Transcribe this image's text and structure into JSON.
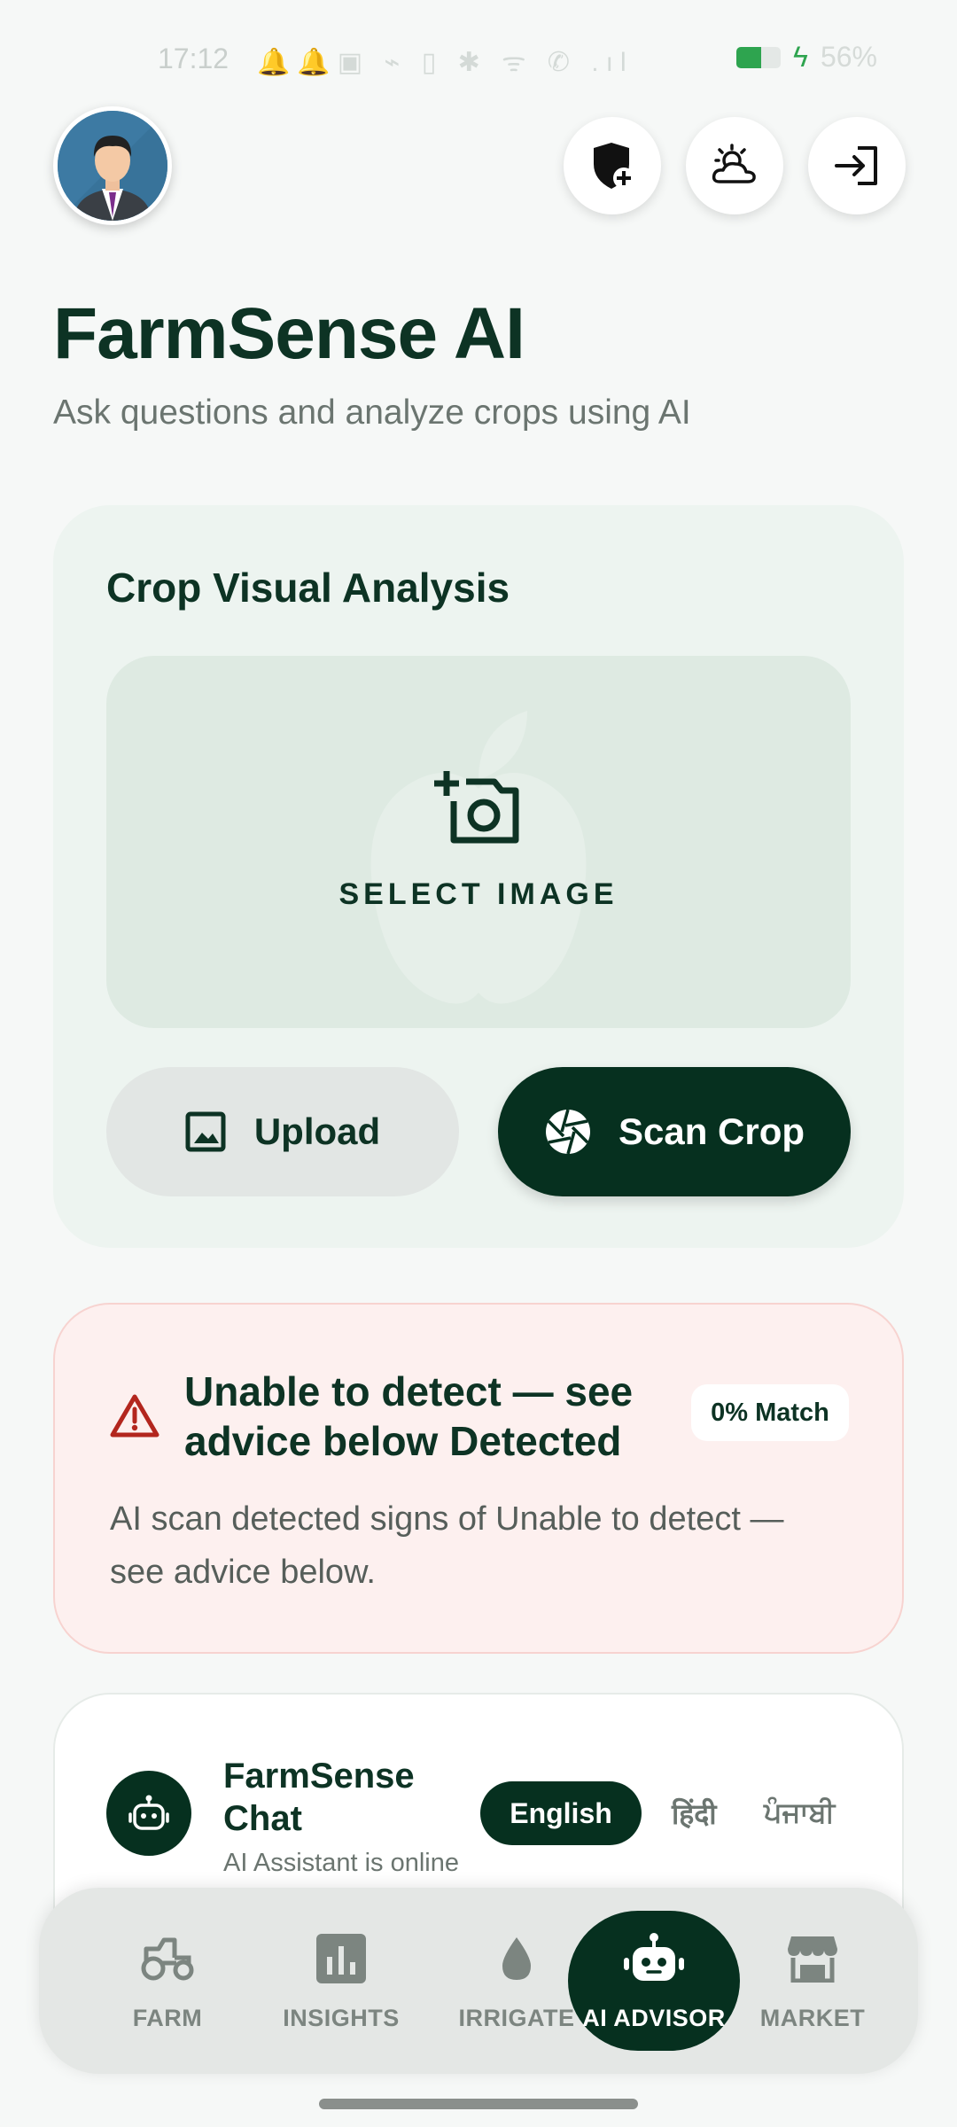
{
  "status_bar": {
    "time": "17:12",
    "battery_percent": "56%",
    "battery_level": 0.56,
    "icons": [
      "notification-icon",
      "notification-icon",
      "gallery-icon",
      "missed-call-icon",
      "vibrate-icon",
      "bluetooth-icon",
      "wifi-icon",
      "call-icon",
      "signal-icon"
    ]
  },
  "header": {
    "title": "FarmSense AI",
    "subtitle": "Ask questions and analyze crops using AI",
    "actions": [
      "shield-plus-icon",
      "weather-icon",
      "logout-icon"
    ]
  },
  "analysis": {
    "title": "Crop Visual Analysis",
    "select_label": "SELECT IMAGE",
    "upload_label": "Upload",
    "scan_label": "Scan Crop"
  },
  "alert": {
    "title": "Unable to detect — see advice below Detected",
    "badge": "0% Match",
    "body": "AI scan detected signs of Unable to detect — see advice below.",
    "accent_color": "#b3261e"
  },
  "chat": {
    "title": "FarmSense Chat",
    "status": "AI Assistant is online",
    "languages": [
      "English",
      "हिंदी",
      "ਪੰਜਾਬੀ"
    ],
    "selected_language": "English"
  },
  "nav": {
    "items": [
      {
        "label": "FARM",
        "icon": "tractor-icon"
      },
      {
        "label": "INSIGHTS",
        "icon": "bar-chart-icon"
      },
      {
        "label": "IRRIGATE",
        "icon": "water-drop-icon"
      },
      {
        "label": "AI ADVISOR",
        "icon": "robot-icon"
      },
      {
        "label": "MARKET",
        "icon": "store-icon"
      }
    ],
    "active": "AI ADVISOR"
  },
  "colors": {
    "primary": "#06301f",
    "background": "#f6f8f7",
    "card": "#edf4f0",
    "alert_bg": "#fdf0ef"
  }
}
